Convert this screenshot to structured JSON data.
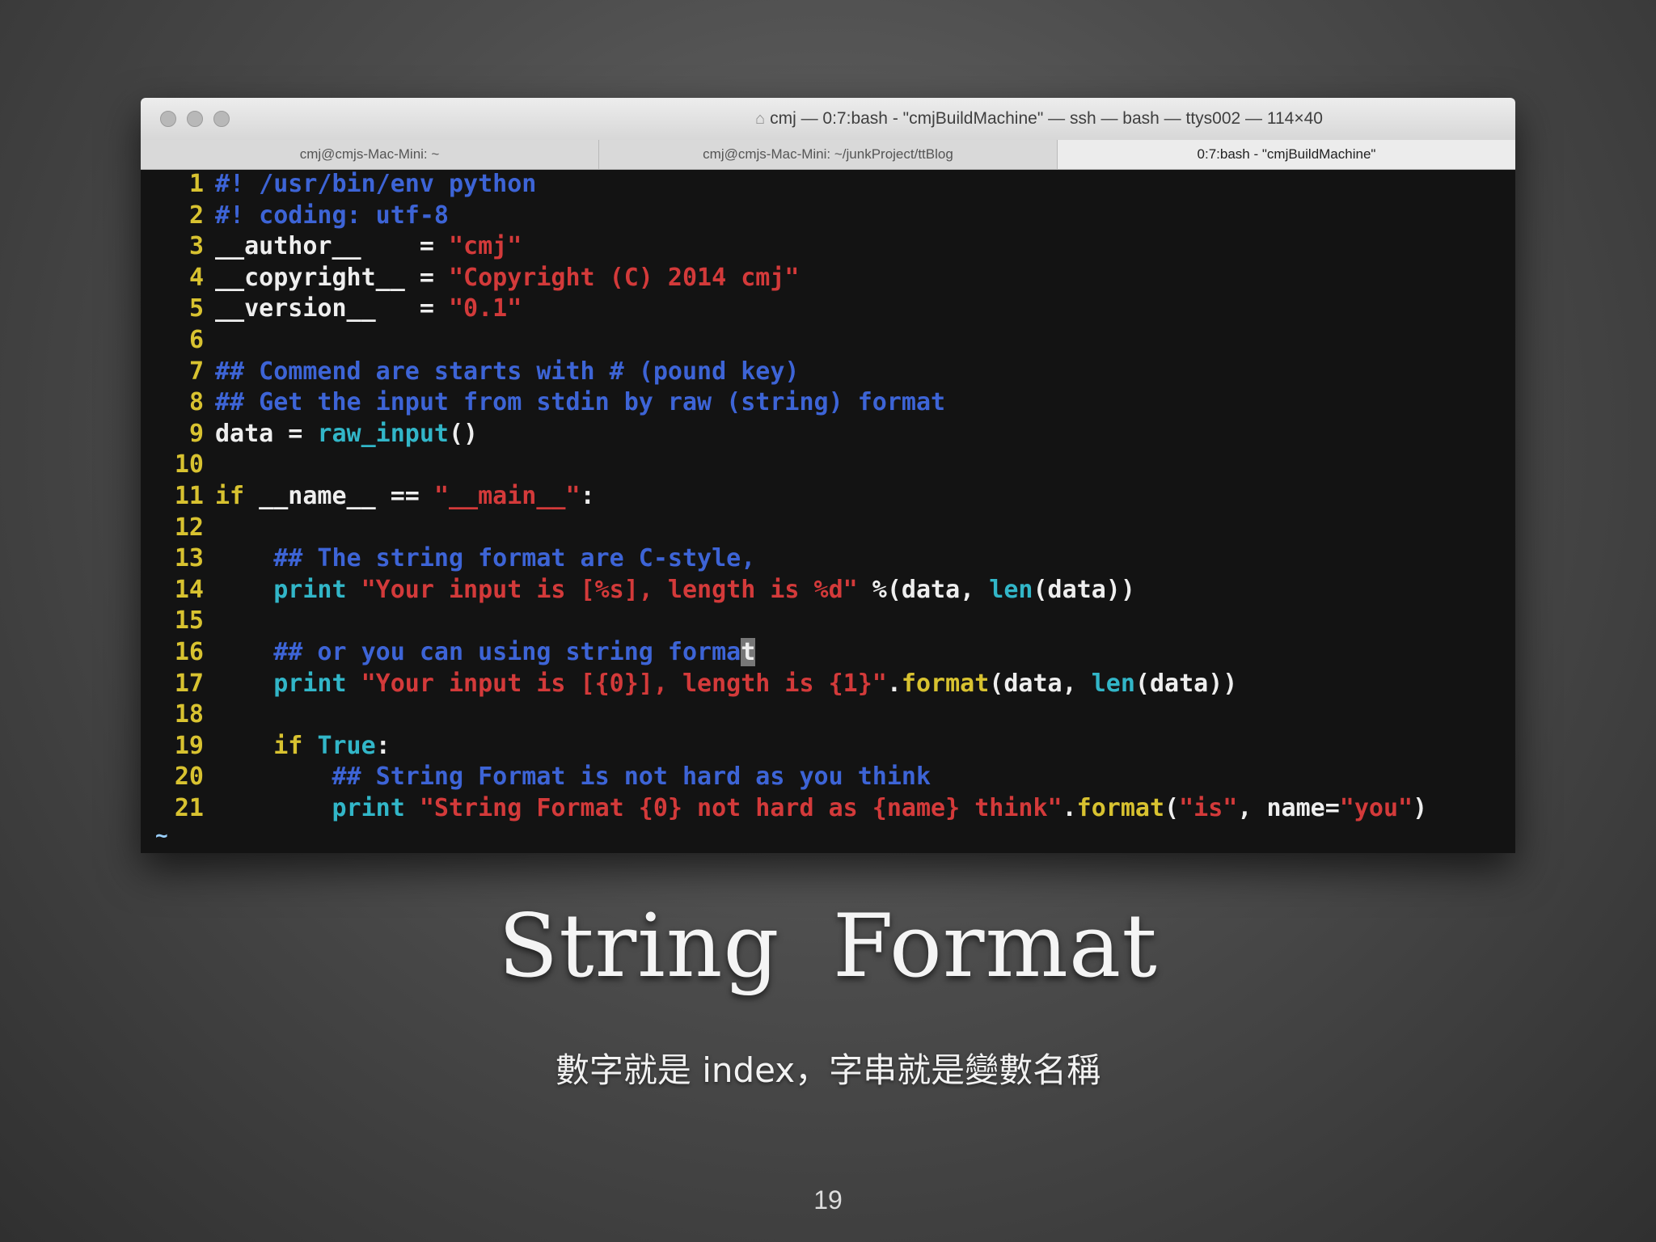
{
  "terminal": {
    "window_title": "cmj — 0:7:bash - \"cmjBuildMachine\" — ssh — bash — ttys002 — 114×40",
    "tabs": [
      {
        "label": "cmj@cmjs-Mac-Mini: ~"
      },
      {
        "label": "cmj@cmjs-Mac-Mini: ~/junkProject/ttBlog"
      },
      {
        "label": "0:7:bash - \"cmjBuildMachine\""
      }
    ],
    "prompt": "~",
    "code_lines": [
      {
        "num": "1",
        "segments": [
          {
            "t": "#! /usr/bin/env python",
            "c": "cmt"
          }
        ]
      },
      {
        "num": "2",
        "segments": [
          {
            "t": "#! coding: utf-8",
            "c": "cmt"
          }
        ]
      },
      {
        "num": "3",
        "segments": [
          {
            "t": "__author__    = ",
            "c": "plain"
          },
          {
            "t": "\"cmj\"",
            "c": "str"
          }
        ]
      },
      {
        "num": "4",
        "segments": [
          {
            "t": "__copyright__ = ",
            "c": "plain"
          },
          {
            "t": "\"Copyright (C) 2014 cmj\"",
            "c": "str"
          }
        ]
      },
      {
        "num": "5",
        "segments": [
          {
            "t": "__version__   = ",
            "c": "plain"
          },
          {
            "t": "\"0.1\"",
            "c": "str"
          }
        ]
      },
      {
        "num": "6",
        "segments": []
      },
      {
        "num": "7",
        "segments": [
          {
            "t": "## Commend are starts with # (pound key)",
            "c": "cmt"
          }
        ]
      },
      {
        "num": "8",
        "segments": [
          {
            "t": "## Get the input from stdin by raw (string) format",
            "c": "cmt"
          }
        ]
      },
      {
        "num": "9",
        "segments": [
          {
            "t": "data = ",
            "c": "plain"
          },
          {
            "t": "raw_input",
            "c": "fn"
          },
          {
            "t": "()",
            "c": "plain"
          }
        ]
      },
      {
        "num": "10",
        "segments": []
      },
      {
        "num": "11",
        "segments": [
          {
            "t": "if",
            "c": "kw"
          },
          {
            "t": " __name__ == ",
            "c": "plain"
          },
          {
            "t": "\"__main__\"",
            "c": "str"
          },
          {
            "t": ":",
            "c": "plain"
          }
        ]
      },
      {
        "num": "12",
        "segments": []
      },
      {
        "num": "13",
        "segments": [
          {
            "t": "    ## The string format are C-style,",
            "c": "cmt"
          }
        ]
      },
      {
        "num": "14",
        "segments": [
          {
            "t": "    ",
            "c": "plain"
          },
          {
            "t": "print",
            "c": "kw2"
          },
          {
            "t": " ",
            "c": "plain"
          },
          {
            "t": "\"Your input is [%s], length is %d\"",
            "c": "str"
          },
          {
            "t": " %(data, ",
            "c": "plain"
          },
          {
            "t": "len",
            "c": "fn"
          },
          {
            "t": "(data))",
            "c": "plain"
          }
        ]
      },
      {
        "num": "15",
        "segments": []
      },
      {
        "num": "16",
        "segments": [
          {
            "t": "    ## or you can using string forma",
            "c": "cmt"
          },
          {
            "t": "t",
            "c": "cursor"
          }
        ]
      },
      {
        "num": "17",
        "segments": [
          {
            "t": "    ",
            "c": "plain"
          },
          {
            "t": "print",
            "c": "kw2"
          },
          {
            "t": " ",
            "c": "plain"
          },
          {
            "t": "\"Your input is [{0}], length is {1}\"",
            "c": "str"
          },
          {
            "t": ".",
            "c": "plain"
          },
          {
            "t": "format",
            "c": "kw"
          },
          {
            "t": "(data, ",
            "c": "plain"
          },
          {
            "t": "len",
            "c": "fn"
          },
          {
            "t": "(data))",
            "c": "plain"
          }
        ]
      },
      {
        "num": "18",
        "segments": []
      },
      {
        "num": "19",
        "segments": [
          {
            "t": "    ",
            "c": "plain"
          },
          {
            "t": "if",
            "c": "kw"
          },
          {
            "t": " ",
            "c": "plain"
          },
          {
            "t": "True",
            "c": "fn"
          },
          {
            "t": ":",
            "c": "plain"
          }
        ]
      },
      {
        "num": "20",
        "segments": [
          {
            "t": "        ## String Format is not hard as you think",
            "c": "cmt"
          }
        ]
      },
      {
        "num": "21",
        "segments": [
          {
            "t": "        ",
            "c": "plain"
          },
          {
            "t": "print",
            "c": "kw2"
          },
          {
            "t": " ",
            "c": "plain"
          },
          {
            "t": "\"String Format {0} not hard as {name} think\"",
            "c": "str"
          },
          {
            "t": ".",
            "c": "plain"
          },
          {
            "t": "format",
            "c": "kw"
          },
          {
            "t": "(",
            "c": "plain"
          },
          {
            "t": "\"is\"",
            "c": "str"
          },
          {
            "t": ", name=",
            "c": "plain"
          },
          {
            "t": "\"you\"",
            "c": "str"
          },
          {
            "t": ")",
            "c": "plain"
          }
        ]
      }
    ]
  },
  "slide": {
    "title": "String Format",
    "subtitle": "數字就是 index，字串就是變數名稱",
    "page_number": "19"
  }
}
